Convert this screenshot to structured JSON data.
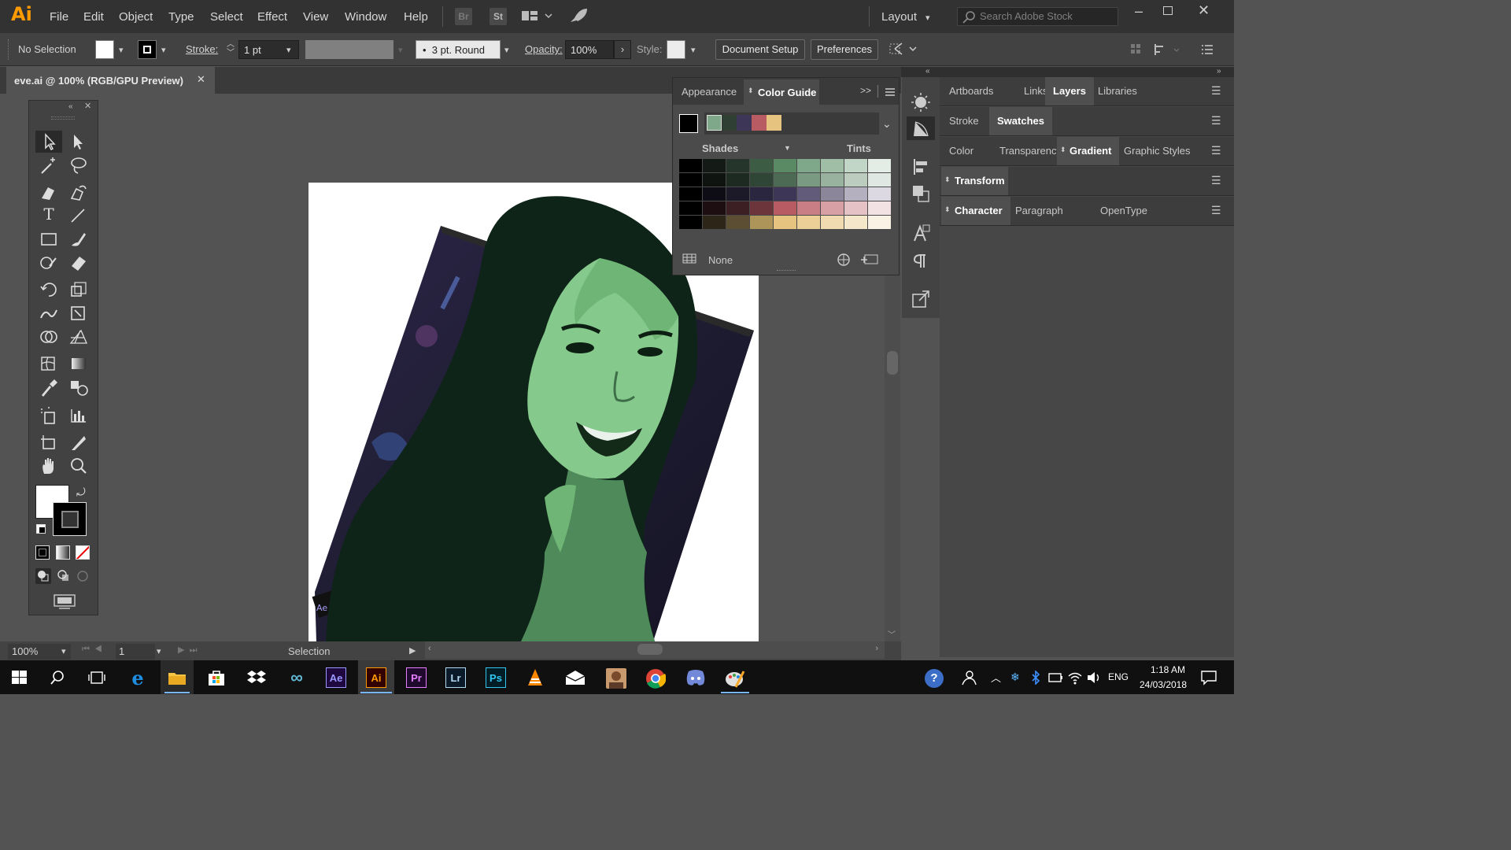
{
  "menubar": {
    "logo": "Ai",
    "items": [
      "File",
      "Edit",
      "Object",
      "Type",
      "Select",
      "Effect",
      "View",
      "Window",
      "Help"
    ],
    "bridge": "Br",
    "stock": "St",
    "layout": "Layout",
    "search_placeholder": "Search Adobe Stock"
  },
  "control": {
    "selection": "No Selection",
    "stroke_label": "Stroke:",
    "stroke_value": "1 pt",
    "brush": "3 pt. Round",
    "opacity_label": "Opacity:",
    "opacity_value": "100%",
    "style_label": "Style:",
    "doc_setup": "Document Setup",
    "preferences": "Preferences"
  },
  "document": {
    "tab_title": "eve.ai @ 100% (RGB/GPU Preview)"
  },
  "status": {
    "zoom": "100%",
    "artboard": "1",
    "tool": "Selection"
  },
  "color_guide": {
    "tabs": [
      "Appearance",
      "Color Guide"
    ],
    "harmony": [
      "#000000",
      "#7fa88a",
      "#2f3f33",
      "#3d3657",
      "#b95b63",
      "#e6c37e"
    ],
    "shades_label": "Shades",
    "tints_label": "Tints",
    "none_label": "None",
    "rows": [
      [
        "#000000",
        "#141a16",
        "#26352b",
        "#3c5c44",
        "#5a8a64",
        "#7fa88a",
        "#a0bea6",
        "#c2d6c7",
        "#e3ede6"
      ],
      [
        "#000000",
        "#101411",
        "#1d2a21",
        "#2f4535",
        "#4d6a55",
        "#7a9a82",
        "#98b29f",
        "#bccdc0",
        "#dfe8e2"
      ],
      [
        "#000000",
        "#0e0c14",
        "#1c1928",
        "#2b2640",
        "#3d3657",
        "#625c7a",
        "#8b8699",
        "#b4b0c0",
        "#dcd9e2"
      ],
      [
        "#000000",
        "#1d0f11",
        "#3b1f22",
        "#6c353b",
        "#b95b63",
        "#c87e84",
        "#d6a0a4",
        "#e4c2c5",
        "#f2e2e3"
      ],
      [
        "#000000",
        "#2c2518",
        "#5c4e33",
        "#ad9458",
        "#e6c37e",
        "#ebcf97",
        "#f0dbb0",
        "#f5e7ca",
        "#faf3e5"
      ]
    ]
  },
  "rightdock": {
    "group1": [
      "Artboards",
      "Links",
      "Layers",
      "Libraries"
    ],
    "group2": [
      "Stroke",
      "Swatches"
    ],
    "group3": [
      "Color",
      "Transparency",
      "Gradient",
      "Graphic Styles"
    ],
    "group4": [
      "Transform"
    ],
    "group5": [
      "Character",
      "Paragraph",
      "OpenType"
    ]
  },
  "taskbar": {
    "apps": [
      "Ae",
      "Ai",
      "Pr",
      "Lr",
      "Ps"
    ],
    "lang": "ENG",
    "time": "1:18 AM",
    "date": "24/03/2018"
  },
  "colors": {
    "accent": "#ff9a00",
    "face": "#86c98c",
    "hair": "#0f2418"
  }
}
